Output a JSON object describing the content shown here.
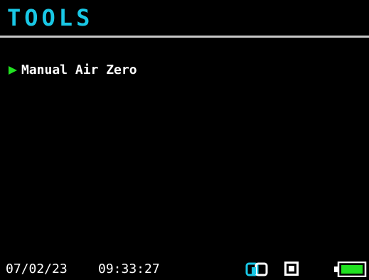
{
  "header": {
    "title": "TOOLS"
  },
  "menu": {
    "items": [
      {
        "label": "Manual Air Zero",
        "selected": true
      }
    ]
  },
  "status_bar": {
    "date": "07/02/23",
    "time": "09:33:27",
    "icons": [
      "link-icon",
      "square-icon",
      "battery-icon"
    ],
    "battery_level": 1.0
  },
  "colors": {
    "title": "#19c8e6",
    "cursor": "#21e221",
    "link_icon": "#19c8e6",
    "battery_fill": "#21e221",
    "background": "#000000"
  }
}
